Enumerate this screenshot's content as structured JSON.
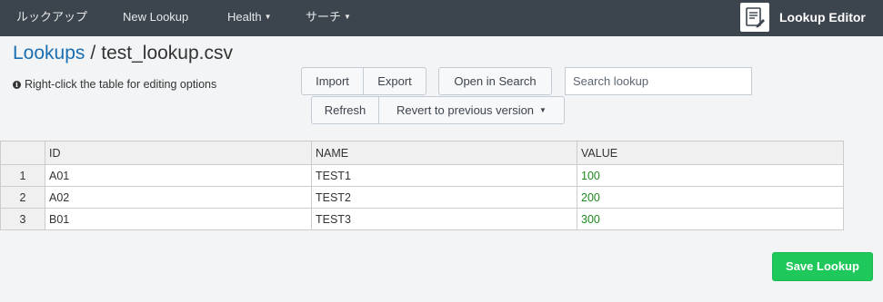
{
  "nav": {
    "items": [
      {
        "label": "ルックアップ",
        "has_caret": false
      },
      {
        "label": "New Lookup",
        "has_caret": false
      },
      {
        "label": "Health",
        "has_caret": true
      },
      {
        "label": "サーチ",
        "has_caret": true
      }
    ],
    "app_name": "Lookup Editor",
    "app_icon": "document-edit-icon"
  },
  "breadcrumb": {
    "parent": "Lookups",
    "separator": "/",
    "current": "test_lookup.csv"
  },
  "hint": "Right-click the table for editing options",
  "toolbar": {
    "import_label": "Import",
    "export_label": "Export",
    "open_in_search_label": "Open in Search",
    "search_placeholder": "Search lookup",
    "refresh_label": "Refresh",
    "revert_label": "Revert to previous version"
  },
  "table": {
    "columns": [
      "ID",
      "NAME",
      "VALUE"
    ],
    "rows": [
      {
        "index": "1",
        "cells": [
          "A01",
          "TEST1",
          "100"
        ]
      },
      {
        "index": "2",
        "cells": [
          "A02",
          "TEST2",
          "200"
        ]
      },
      {
        "index": "3",
        "cells": [
          "B01",
          "TEST3",
          "300"
        ]
      }
    ]
  },
  "save_label": "Save Lookup",
  "colors": {
    "nav_background": "#3c444d",
    "link": "#1a6fb3",
    "numeric_value": "#1e8a1e",
    "save_button": "#1ec85a"
  }
}
